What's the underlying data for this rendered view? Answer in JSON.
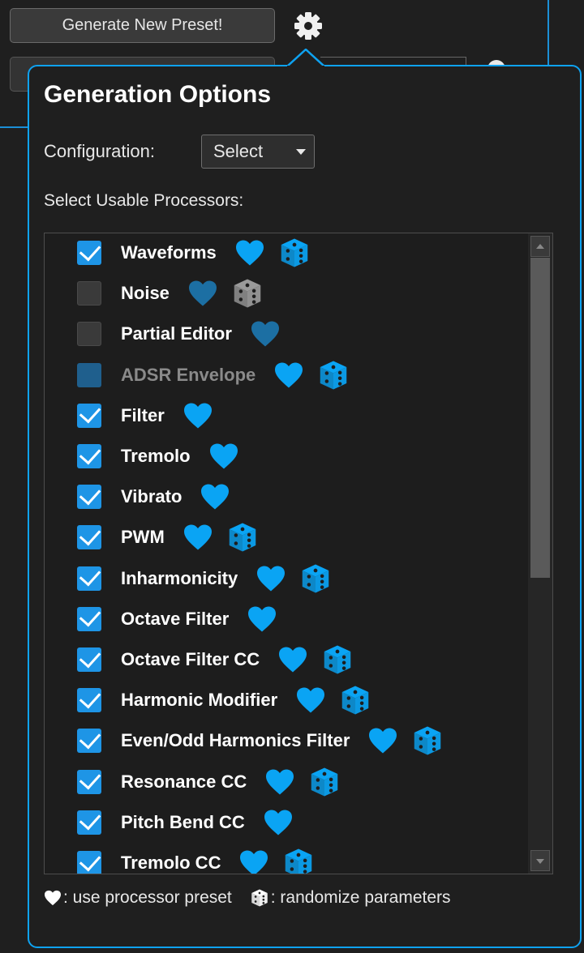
{
  "top_bar": {
    "generate_label": "Generate New Preset!"
  },
  "panel": {
    "title": "Generation Options",
    "config_label": "Configuration:",
    "config_value": "Select",
    "processors_label": "Select Usable Processors:",
    "scroll_level": 0.0
  },
  "processors": [
    {
      "label": "Waveforms",
      "state": "checked",
      "heart": "active",
      "dice": "active"
    },
    {
      "label": "Noise",
      "state": "unchecked",
      "heart": "dim",
      "dice": "gray"
    },
    {
      "label": "Partial Editor",
      "state": "unchecked",
      "heart": "dim",
      "dice": "none"
    },
    {
      "label": "ADSR Envelope",
      "state": "disabled",
      "heart": "active",
      "dice": "active"
    },
    {
      "label": "Filter",
      "state": "checked",
      "heart": "active",
      "dice": "none"
    },
    {
      "label": "Tremolo",
      "state": "checked",
      "heart": "active",
      "dice": "none"
    },
    {
      "label": "Vibrato",
      "state": "checked",
      "heart": "active",
      "dice": "none"
    },
    {
      "label": "PWM",
      "state": "checked",
      "heart": "active",
      "dice": "active"
    },
    {
      "label": "Inharmonicity",
      "state": "checked",
      "heart": "active",
      "dice": "active"
    },
    {
      "label": "Octave Filter",
      "state": "checked",
      "heart": "active",
      "dice": "none"
    },
    {
      "label": "Octave Filter CC",
      "state": "checked",
      "heart": "active",
      "dice": "active"
    },
    {
      "label": "Harmonic Modifier",
      "state": "checked",
      "heart": "active",
      "dice": "active"
    },
    {
      "label": "Even/Odd Harmonics Filter",
      "state": "checked",
      "heart": "active",
      "dice": "active"
    },
    {
      "label": "Resonance CC",
      "state": "checked",
      "heart": "active",
      "dice": "active"
    },
    {
      "label": "Pitch Bend CC",
      "state": "checked",
      "heart": "active",
      "dice": "none"
    },
    {
      "label": "Tremolo CC",
      "state": "checked",
      "heart": "active",
      "dice": "active"
    }
  ],
  "legend": {
    "heart_text": ": use processor preset",
    "dice_text": ": randomize parameters"
  },
  "colors": {
    "accent": "#0ea2f1",
    "heart_active": "#0aa4f4",
    "heart_dim": "#1c6fa3",
    "dice_gray": "#9a9a9a"
  }
}
